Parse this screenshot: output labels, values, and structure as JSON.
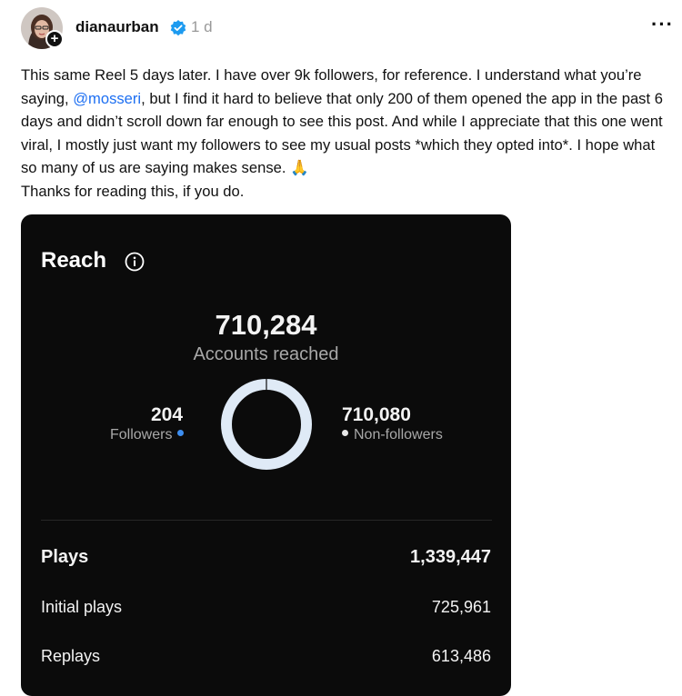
{
  "post": {
    "username": "dianaurban",
    "time": "1 d",
    "text_before_mention": "This same Reel 5 days later. I have over 9k followers, for reference. I understand what you’re saying, ",
    "mention": "@mosseri",
    "text_after_mention": ", but I find it hard to believe that only 200 of them opened the app in the past 6 days and didn’t scroll down far enough to see this post. And while I appreciate that this one went viral, I mostly just want my followers to see my usual posts *which they opted into*. I hope what so many of us are saying makes sense. 🙏",
    "text_line_last": "Thanks for reading this, if you do."
  },
  "icons": {
    "avatar": "avatar-photo",
    "follow": "plus-icon",
    "verified": "verified-badge-icon",
    "more": "more-options-icon",
    "info": "info-icon"
  },
  "colors": {
    "mention": "#1d6ff2",
    "verified": "#1d9bf0",
    "card_background": "#0b0b0b",
    "followers_dot": "#3d8ef0"
  },
  "insights": {
    "title": "Reach",
    "accounts_reached": "710,284",
    "accounts_reached_label": "Accounts reached",
    "followers_count": "204",
    "followers_label": "Followers",
    "non_followers_count": "710,080",
    "non_followers_label": "Non-followers",
    "rows": [
      {
        "label": "Plays",
        "value": "1,339,447"
      },
      {
        "label": "Initial plays",
        "value": "725,961"
      },
      {
        "label": "Replays",
        "value": "613,486"
      }
    ]
  }
}
